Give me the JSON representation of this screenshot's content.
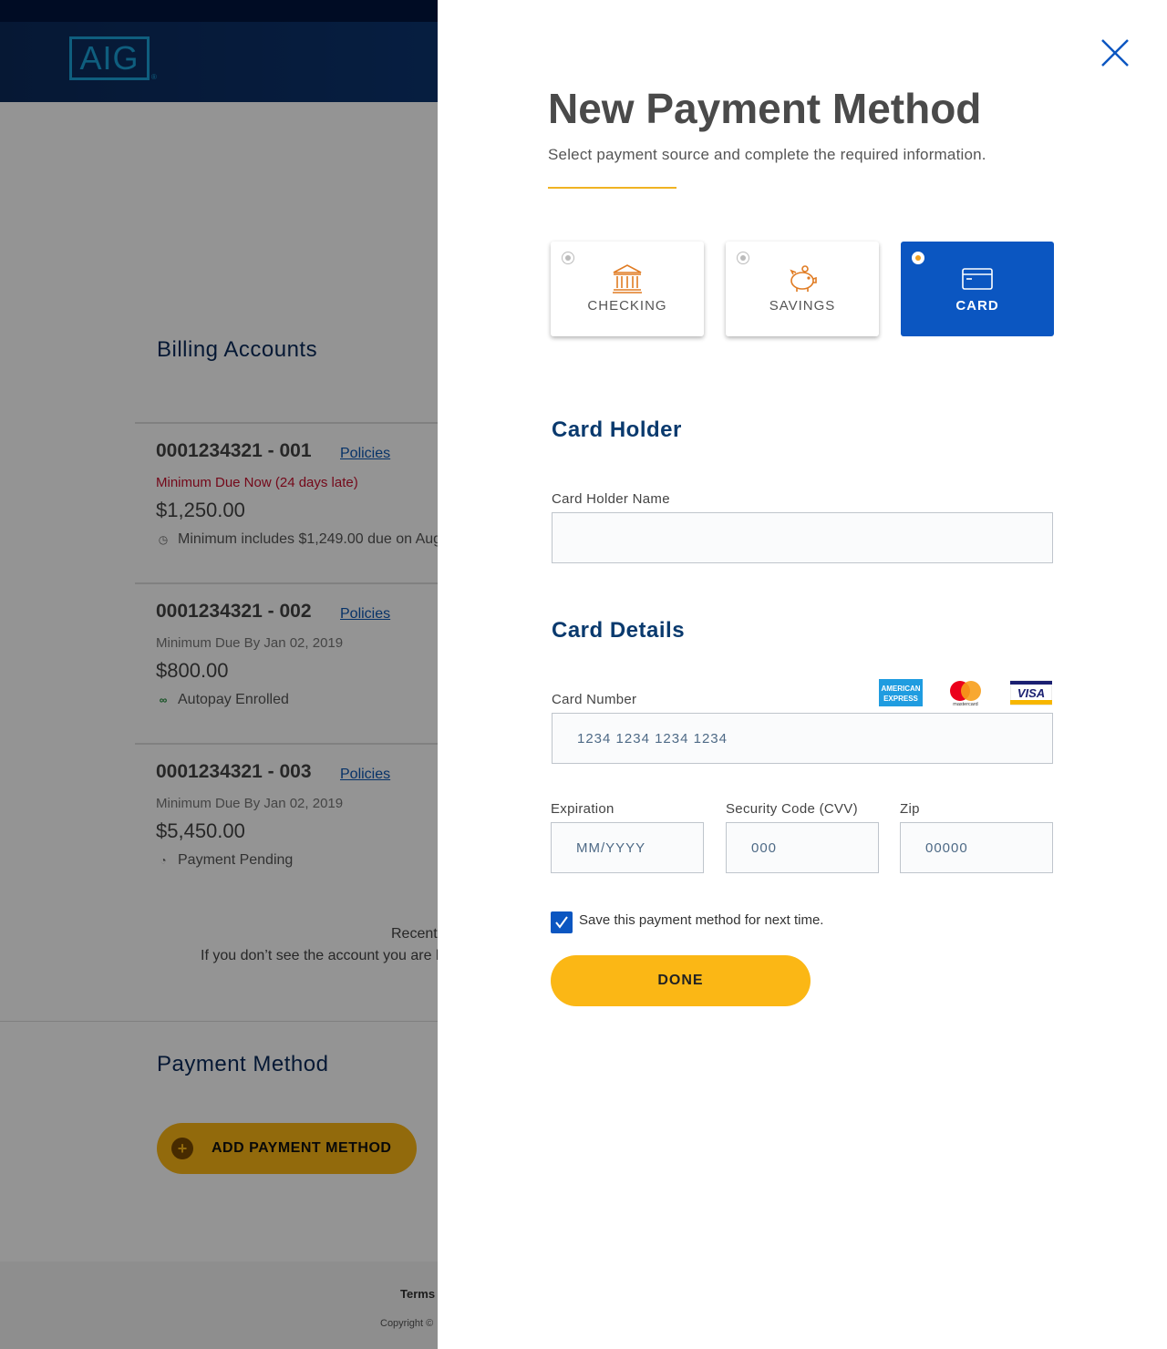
{
  "header": {
    "logo_text": "AIG",
    "logo_reg": "®"
  },
  "billing": {
    "title": "Billing Accounts",
    "accounts": [
      {
        "id": "0001234321 - 001",
        "link": "Policies",
        "due": "Minimum Due Now (24 days late)",
        "amount": "$1,250.00",
        "note": "Minimum includes $1,249.00 due on Aug",
        "note_icon": "clock-icon"
      },
      {
        "id": "0001234321 - 002",
        "link": "Policies",
        "due": "Minimum Due By Jan 02, 2019",
        "amount": "$800.00",
        "note": "Autopay Enrolled",
        "note_icon": "autopay-icon"
      },
      {
        "id": "0001234321 - 003",
        "link": "Policies",
        "due": "Minimum Due By Jan 02, 2019",
        "amount": "$5,450.00",
        "note": "Payment Pending",
        "note_icon": "pending-icon"
      }
    ],
    "recent_text": "Recent",
    "not_see_text": "If you don’t see the account you are lo"
  },
  "payment_section": {
    "title": "Payment Method",
    "add_button": "ADD PAYMENT METHOD"
  },
  "footer": {
    "terms": "Terms",
    "copyright": "Copyright ©"
  },
  "drawer": {
    "title": "New Payment Method",
    "subtitle": "Select payment source and complete the required information.",
    "options": [
      {
        "label": "CHECKING",
        "icon": "bank-icon",
        "selected": false
      },
      {
        "label": "SAVINGS",
        "icon": "piggy-bank-icon",
        "selected": false
      },
      {
        "label": "CARD",
        "icon": "credit-card-icon",
        "selected": true
      }
    ],
    "card_holder": {
      "heading": "Card Holder",
      "name_label": "Card Holder Name",
      "name_value": ""
    },
    "card_details": {
      "heading": "Card Details",
      "number_label": "Card Number",
      "number_placeholder": "1234 1234 1234 1234",
      "brands": [
        "amex-icon",
        "mastercard-icon",
        "visa-icon"
      ],
      "expiration_label": "Expiration",
      "expiration_placeholder": "MM/YYYY",
      "cvv_label": "Security Code (CVV)",
      "cvv_placeholder": "000",
      "zip_label": "Zip",
      "zip_placeholder": "00000"
    },
    "save_checked": true,
    "save_label": "Save this payment method for next time.",
    "done_button": "DONE"
  },
  "colors": {
    "primary": "#0b56c1",
    "accent": "#fbb715",
    "heading": "#0a3a6e",
    "late": "#c8102e"
  }
}
